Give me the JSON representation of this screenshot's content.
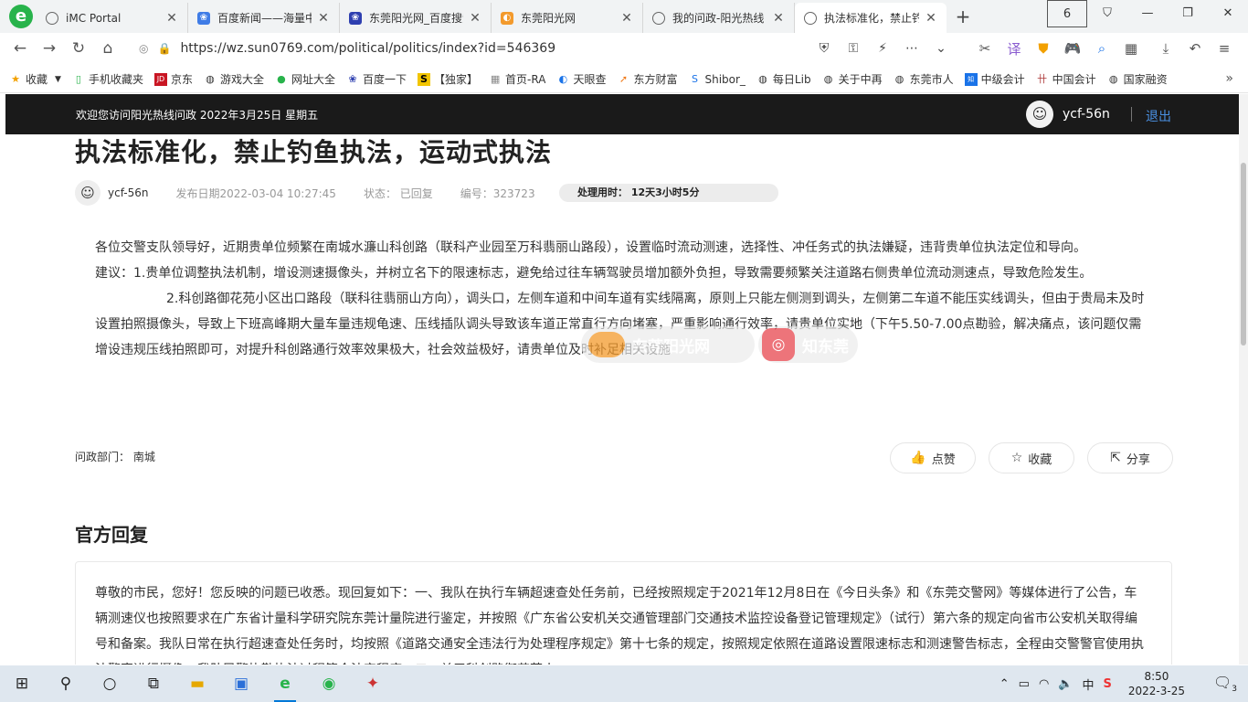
{
  "tabs": [
    {
      "label": "iMC Portal",
      "icon": "globe-icon",
      "active": false
    },
    {
      "label": "百度新闻——海量中",
      "icon": "baidu-news-icon",
      "active": false
    },
    {
      "label": "东莞阳光网_百度搜索",
      "icon": "baidu-icon",
      "active": false
    },
    {
      "label": "东莞阳光网",
      "icon": "sun0769-icon",
      "active": false
    },
    {
      "label": "我的问政-阳光热线",
      "icon": "globe-icon",
      "active": false
    },
    {
      "label": "执法标准化，禁止钓",
      "icon": "globe-icon",
      "active": true
    }
  ],
  "tab_count_badge": "6",
  "address": {
    "url": "https://wz.sun0769.com/political/politics/index?id=546369"
  },
  "bookmarks": [
    {
      "label": "收藏",
      "icon": "star-icon"
    },
    {
      "label": "手机收藏夹",
      "icon": "phone-icon"
    },
    {
      "label": "京东",
      "icon": "jd-icon"
    },
    {
      "label": "游戏大全",
      "icon": "globe-icon"
    },
    {
      "label": "网址大全",
      "icon": "hao123-icon"
    },
    {
      "label": "百度一下",
      "icon": "baidu-icon"
    },
    {
      "label": "【独家】",
      "icon": "s-icon"
    },
    {
      "label": "首页-RA",
      "icon": "grid-icon"
    },
    {
      "label": "天眼查",
      "icon": "tianyan-icon"
    },
    {
      "label": "东方财富",
      "icon": "eastmoney-icon"
    },
    {
      "label": "Shibor_",
      "icon": "shibor-icon"
    },
    {
      "label": "每日Lib",
      "icon": "globe-icon"
    },
    {
      "label": "关于中再",
      "icon": "globe-icon"
    },
    {
      "label": "东莞市人",
      "icon": "globe-icon"
    },
    {
      "label": "中级会计",
      "icon": "zhihu-icon"
    },
    {
      "label": "中国会计",
      "icon": "grid-icon"
    },
    {
      "label": "国家融资",
      "icon": "globe-icon"
    }
  ],
  "site_header": {
    "welcome": "欢迎您访问阳光热线问政 2022年3月25日 星期五",
    "username": "ycf-56n",
    "logout": "退出"
  },
  "article": {
    "title": "执法标准化，禁止钓鱼执法，运动式执法",
    "author": "ycf-56n",
    "published": "发布日期2022-03-04 10:27:45",
    "status": "状态：  已回复",
    "number": "编号：323723",
    "processing_time": "处理用时：  12天3小时5分",
    "paragraphs": [
      "各位交警支队领导好，近期贵单位频繁在南城水濂山科创路（联科产业园至万科翡丽山路段），设置临时流动测速，选择性、冲任务式的执法嫌疑，违背贵单位执法定位和导向。",
      "建议：1.贵单位调整执法机制，增设测速摄像头，并树立名下的限速标志，避免给过往车辆驾驶员增加额外负担，导致需要频繁关注道路右侧贵单位流动测速点，导致危险发生。",
      "2.科创路御花苑小区出口路段（联科往翡丽山方向），调头口，左侧车道和中间车道有实线隔离，原则上只能左侧测到调头，左侧第二车道不能压实线调头，但由于贵局未及时设置拍照摄像头，导致上下班高峰期大量车量违规龟速、压线插队调头导致该车道正常直行方向堵塞，严重影响通行效率，请贵单位实地（下午5.50-7.00点勘验，解决痛点，该问题仅需增设违规压线拍照即可，对提升科创路通行效率效果极大，社会效益极好，请贵单位及时补足相关设施"
    ],
    "department": "问政部门：  南城",
    "watermark_left": "东莞阳光网",
    "watermark_right": "知东莞"
  },
  "actions": {
    "like": "点赞",
    "favorite": "收藏",
    "share": "分享"
  },
  "reply": {
    "heading": "官方回复",
    "text": "尊敬的市民，您好！您反映的问题已收悉。现回复如下：一、我队在执行车辆超速查处任务前，已经按照规定于2021年12月8日在《今日头条》和《东莞交警网》等媒体进行了公告，车辆测速仪也按照要求在广东省计量科学研究院东莞计量院进行鉴定，并按照《广东省公安机关交通管理部门交通技术监控设备登记管理规定》（试行）第六条的规定向省市公安机关取得编号和备案。我队日常在执行超速查处任务时，均按照《道路交通安全违法行为处理程序规定》第十七条的规定，按照规定依照在道路设置限速标志和测速警告标志，全程由交警警官使用执法警官进行摄像，我队民警执勤执法过程符合法定程序。二、关于科创路御花苑小"
  },
  "taskbar": {
    "time": "8:50",
    "date": "2022-3-25",
    "ime": "中",
    "notif_count": "3"
  },
  "colors": {
    "site_header_bg": "#1a1a1a",
    "logout_link": "#4a90e2",
    "browser_logo": "#28b34b"
  }
}
